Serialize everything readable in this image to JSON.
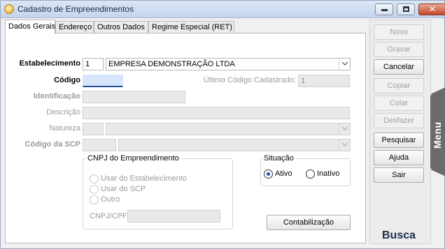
{
  "window": {
    "title": "Cadastro de Empreendimentos",
    "icon": "coin-icon",
    "controls": {
      "minimize": "minimize-icon",
      "maximize": "maximize-icon",
      "close": "✕"
    }
  },
  "tabs": [
    {
      "label": "Dados Gerais",
      "active": true
    },
    {
      "label": "Endereço",
      "active": false
    },
    {
      "label": "Outros Dados",
      "active": false
    },
    {
      "label": "Regime Especial (RET)",
      "active": false
    }
  ],
  "form": {
    "estabelecimento": {
      "label": "Estabelecimento",
      "code": "1",
      "name": "EMPRESA DEMONSTRAÇÃO LTDA"
    },
    "codigo": {
      "label": "Código",
      "value": ""
    },
    "ultimo_codigo": {
      "label": "Último Código Cadastrado:",
      "value": "1"
    },
    "identificacao": {
      "label": "Identificação",
      "value": ""
    },
    "descricao": {
      "label": "Descrição",
      "value": ""
    },
    "natureza": {
      "label": "Natureza",
      "code": "",
      "value": ""
    },
    "codigo_scp": {
      "label": "Código da SCP",
      "code": "",
      "value": ""
    }
  },
  "cnpj_group": {
    "title": "CNPJ do Empreendimento",
    "options": [
      "Usar do Estabelecimento",
      "Usar do SCP",
      "Outro"
    ],
    "cnpj_label": "CNPJ/CPF",
    "cnpj_value": ""
  },
  "situacao_group": {
    "title": "Situação",
    "options": [
      {
        "label": "Ativo",
        "selected": true
      },
      {
        "label": "Inativo",
        "selected": false
      }
    ]
  },
  "contabilizacao_button": "Contabilização",
  "side_buttons": [
    {
      "label": "Novo",
      "enabled": false
    },
    {
      "label": "Gravar",
      "enabled": false
    },
    {
      "label": "Cancelar",
      "enabled": true
    },
    {
      "label": "Copiar",
      "enabled": false
    },
    {
      "label": "Colar",
      "enabled": false
    },
    {
      "label": "Desfazer",
      "enabled": false
    },
    {
      "label": "Pesquisar",
      "enabled": true
    },
    {
      "label": "Ajuda",
      "enabled": true
    },
    {
      "label": "Sair",
      "enabled": true
    }
  ],
  "menu_tab": "Menu",
  "busca_label": "Busca"
}
